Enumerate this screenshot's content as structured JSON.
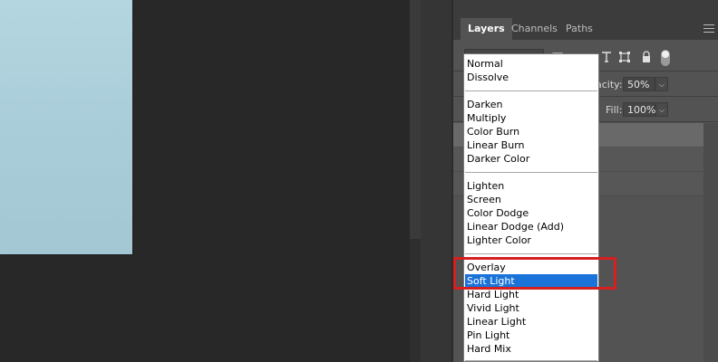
{
  "panel": {
    "tabs": [
      {
        "label": "Layers",
        "active": true
      },
      {
        "label": "Channels",
        "active": false
      },
      {
        "label": "Paths",
        "active": false
      }
    ],
    "menu_icon": "hamburger-icon",
    "opacity_label": "pacity:",
    "opacity_value": "50%",
    "fill_label": "Fill:",
    "fill_value": "100%",
    "tool_icons": [
      "pixel-lock-icon",
      "type-icon",
      "crop-icon",
      "lock-icon",
      "toggle-icon"
    ]
  },
  "blend_menu": {
    "selected": "Soft Light",
    "groups": [
      [
        "Normal",
        "Dissolve"
      ],
      [
        "Darken",
        "Multiply",
        "Color Burn",
        "Linear Burn",
        "Darker Color"
      ],
      [
        "Lighten",
        "Screen",
        "Color Dodge",
        "Linear Dodge (Add)",
        "Lighter Color"
      ],
      [
        "Overlay",
        "Soft Light",
        "Hard Light",
        "Vivid Light",
        "Linear Light",
        "Pin Light",
        "Hard Mix"
      ]
    ]
  },
  "annotation": {
    "color": "#d61f1f",
    "target": "Overlay / Soft Light"
  }
}
